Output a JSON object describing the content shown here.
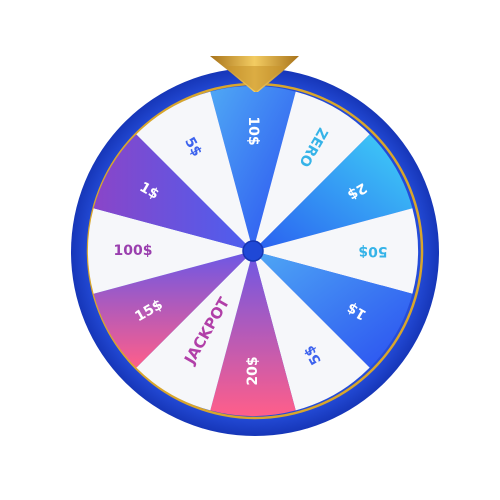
{
  "wheel": {
    "segments": [
      {
        "label": "10$",
        "style": "blue",
        "text_color": "#ffffff"
      },
      {
        "label": "ZERO",
        "style": "white",
        "text_color": "#35b3e8"
      },
      {
        "label": "2$",
        "style": "cyan",
        "text_color": "#ffffff"
      },
      {
        "label": "50$",
        "style": "white",
        "text_color": "#35b3e8"
      },
      {
        "label": "1$",
        "style": "blue",
        "text_color": "#ffffff"
      },
      {
        "label": "5$",
        "style": "white",
        "text_color": "#3d63ee"
      },
      {
        "label": "20$",
        "style": "pink",
        "text_color": "#ffffff"
      },
      {
        "label": "JACKPOT",
        "style": "white",
        "text_color": "#b13fa8"
      },
      {
        "label": "15$",
        "style": "pink",
        "text_color": "#ffffff"
      },
      {
        "label": "100$",
        "style": "white",
        "text_color": "#9a3fae"
      },
      {
        "label": "1$",
        "style": "purple",
        "text_color": "#ffffff"
      },
      {
        "label": "5$",
        "style": "white",
        "text_color": "#3d63ee"
      }
    ]
  },
  "colors": {
    "rim": "#1f48d6",
    "rim_dark": "#1535b2",
    "gold": "#d8a62c",
    "hub": "#1f48d6",
    "white_segment": "#f6f7fa"
  },
  "icons": {
    "pointer": "gold-triangle-pointer-icon",
    "hub": "center-hub-icon"
  }
}
